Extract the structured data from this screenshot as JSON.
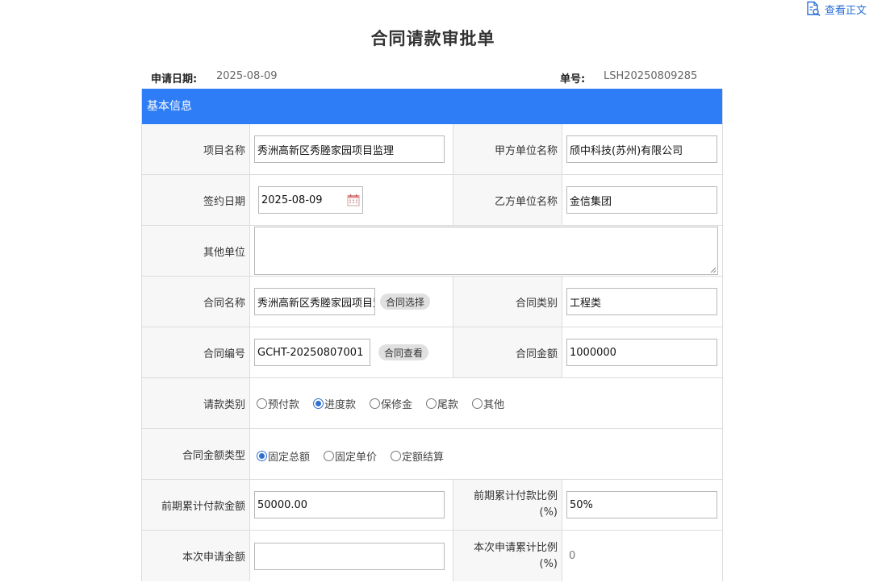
{
  "header": {
    "view_doc_label": "查看正文",
    "title": "合同请款审批单"
  },
  "meta": {
    "apply_date_label": "申请日期:",
    "apply_date": "2025-08-09",
    "number_label": "单号:",
    "number": "LSH20250809285"
  },
  "form": {
    "section_title": "基本信息",
    "project_name_label": "项目名称",
    "project_name": "秀洲高新区秀塍家园项目监理",
    "party_a_label": "甲方单位名称",
    "party_a": "颀中科技(苏州)有限公司",
    "sign_date_label": "签约日期",
    "sign_date": "2025-08-09",
    "party_b_label": "乙方单位名称",
    "party_b": "金信集团",
    "other_units_label": "其他单位",
    "other_units": "",
    "contract_name_label": "合同名称",
    "contract_name": "秀洲高新区秀塍家园项目监理",
    "contract_select_button": "合同选择",
    "contract_type_label": "合同类别",
    "contract_type": "工程类",
    "contract_no_label": "合同编号",
    "contract_no": "GCHT-20250807001",
    "contract_view_button": "合同查看",
    "contract_amount_label": "合同金额",
    "contract_amount": "1000000",
    "payment_type_label": "请款类别",
    "payment_type_options": [
      {
        "label": "预付款",
        "checked": false
      },
      {
        "label": "进度款",
        "checked": true
      },
      {
        "label": "保修金",
        "checked": false
      },
      {
        "label": "尾款",
        "checked": false
      },
      {
        "label": "其他",
        "checked": false
      }
    ],
    "amount_type_label": "合同金额类型",
    "amount_type_options": [
      {
        "label": "固定总额",
        "checked": true
      },
      {
        "label": "固定单价",
        "checked": false
      },
      {
        "label": "定额结算",
        "checked": false
      }
    ],
    "prev_paid_label": "前期累计付款金额",
    "prev_paid": "50000.00",
    "prev_ratio_label_1": "前期累计付款比例",
    "prev_ratio_label_2": "(%)",
    "prev_ratio": "50%",
    "current_amount_label": "本次申请金额",
    "current_amount": "",
    "current_ratio_label_1": "本次申请累计比例",
    "current_ratio_label_2": "(%)",
    "current_ratio": "0"
  },
  "colors": {
    "section_bg": "#2f7df6",
    "link": "#2a6fd6",
    "radio_checked": "#2f6fd0"
  }
}
